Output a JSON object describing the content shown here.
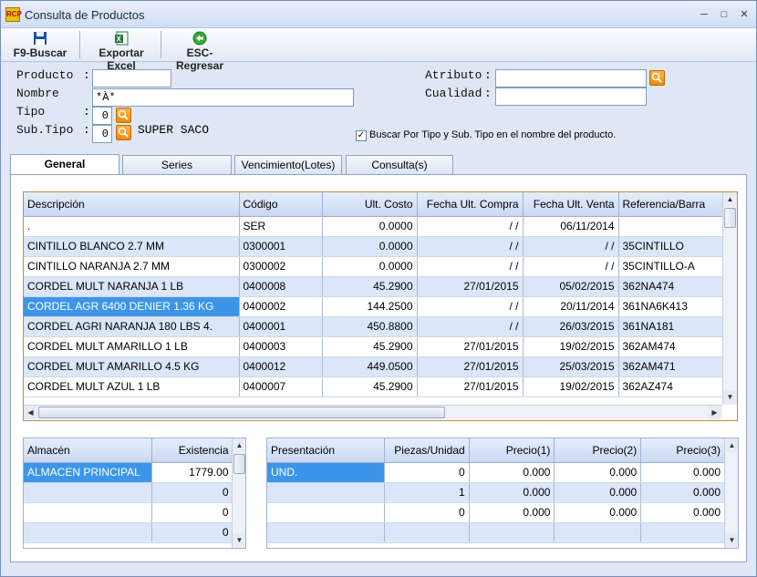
{
  "window": {
    "title": "Consulta de Productos"
  },
  "toolbar": {
    "search_label": "F9-Buscar",
    "export_label": "Exportar Excel",
    "back_label": "ESC-Regresar"
  },
  "form": {
    "producto_label": "Producto",
    "producto_value": "",
    "nombre_label": "Nombre",
    "nombre_value": "*À*",
    "tipo_label": "Tipo",
    "tipo_value": "0",
    "subtipo_label": "Sub.Tipo",
    "subtipo_value": "0",
    "subtipo_desc": "SUPER SACO",
    "atributo_label": "Atributo",
    "atributo_value": "",
    "cualidad_label": "Cualidad",
    "cualidad_value": "",
    "colon": ":",
    "checkbox_label": "Buscar Por Tipo y Sub. Tipo en el nombre del producto.",
    "checkbox_checked": true
  },
  "tabs": [
    "General",
    "Series",
    "Vencimiento(Lotes)",
    "Consulta(s)"
  ],
  "products": {
    "headers": [
      "Descripción",
      "Código",
      "Ult. Costo",
      "Fecha Ult. Compra",
      "Fecha Ult. Venta",
      "Referencia/Barra"
    ],
    "rows": [
      [
        ".",
        "SER",
        "0.0000",
        "/ /",
        "06/11/2014",
        ""
      ],
      [
        "CINTILLO BLANCO 2.7 MM",
        "0300001",
        "0.0000",
        "/ /",
        "/ /",
        "35CINTILLO"
      ],
      [
        "CINTILLO NARANJA 2.7 MM",
        "0300002",
        "0.0000",
        "/ /",
        "/ /",
        "35CINTILLO-A"
      ],
      [
        "CORDEL  MULT NARANJA 1 LB",
        "0400008",
        "45.2900",
        "27/01/2015",
        "05/02/2015",
        "362NA474"
      ],
      [
        "CORDEL AGR 6400 DENIER 1.36 KG",
        "0400002",
        "144.2500",
        "/ /",
        "20/11/2014",
        "361NA6K413"
      ],
      [
        "CORDEL AGRI NARANJA 180 LBS 4.",
        "0400001",
        "450.8800",
        "/ /",
        "26/03/2015",
        "361NA181"
      ],
      [
        "CORDEL MULT AMARILLO 1 LB",
        "0400003",
        "45.2900",
        "27/01/2015",
        "19/02/2015",
        "362AM474"
      ],
      [
        "CORDEL MULT AMARILLO 4.5 KG",
        "0400012",
        "449.0500",
        "27/01/2015",
        "25/03/2015",
        "362AM471"
      ],
      [
        "CORDEL MULT AZUL 1 LB",
        "0400007",
        "45.2900",
        "27/01/2015",
        "19/02/2015",
        "362AZ474"
      ]
    ]
  },
  "stock": {
    "headers": [
      "Almacén",
      "Existencia"
    ],
    "rows": [
      [
        "ALMACEN PRINCIPAL",
        "1779.00"
      ],
      [
        "",
        "0"
      ],
      [
        "",
        "0"
      ],
      [
        "",
        "0"
      ]
    ]
  },
  "prices": {
    "headers": [
      "Presentación",
      "Piezas/Unidad",
      "Precio(1)",
      "Precio(2)",
      "Precio(3)"
    ],
    "rows": [
      [
        "UND.",
        "0",
        "0.000",
        "0.000",
        "0.000"
      ],
      [
        "",
        "1",
        "0.000",
        "0.000",
        "0.000"
      ],
      [
        "",
        "0",
        "0.000",
        "0.000",
        "0.000"
      ],
      [
        "",
        "",
        "",
        "",
        ""
      ]
    ]
  }
}
